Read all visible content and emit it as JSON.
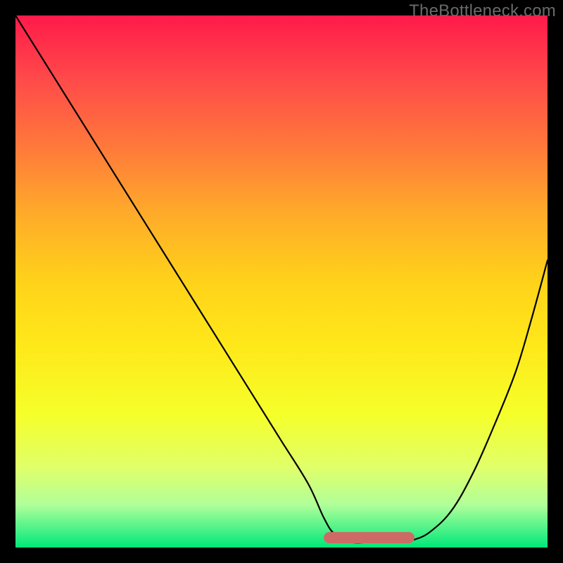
{
  "watermark": "TheBottleneck.com",
  "chart_data": {
    "type": "line",
    "title": "",
    "xlabel": "",
    "ylabel": "",
    "xlim": [
      0,
      100
    ],
    "ylim": [
      0,
      100
    ],
    "series": [
      {
        "name": "curve",
        "x": [
          0,
          5,
          10,
          15,
          20,
          25,
          30,
          35,
          40,
          45,
          50,
          55,
          58,
          60,
          63,
          67,
          72,
          75,
          78,
          82,
          86,
          90,
          94,
          97,
          100
        ],
        "values": [
          100,
          92,
          84,
          76,
          68,
          60,
          52,
          44,
          36,
          28,
          20,
          12,
          5.5,
          2.5,
          1,
          1,
          1,
          1.5,
          3,
          7,
          14,
          23,
          33,
          43,
          54
        ]
      }
    ],
    "accent_range_x": [
      58,
      75
    ],
    "gradient_stops": [
      {
        "pos": 0,
        "color": "#ff1a4a"
      },
      {
        "pos": 12,
        "color": "#ff4a4a"
      },
      {
        "pos": 25,
        "color": "#ff7a3a"
      },
      {
        "pos": 37,
        "color": "#ffaa2a"
      },
      {
        "pos": 50,
        "color": "#ffd21a"
      },
      {
        "pos": 62,
        "color": "#ffe81a"
      },
      {
        "pos": 75,
        "color": "#f5ff2a"
      },
      {
        "pos": 85,
        "color": "#e0ff6a"
      },
      {
        "pos": 92,
        "color": "#b0ff9a"
      },
      {
        "pos": 100,
        "color": "#00e87a"
      }
    ]
  }
}
